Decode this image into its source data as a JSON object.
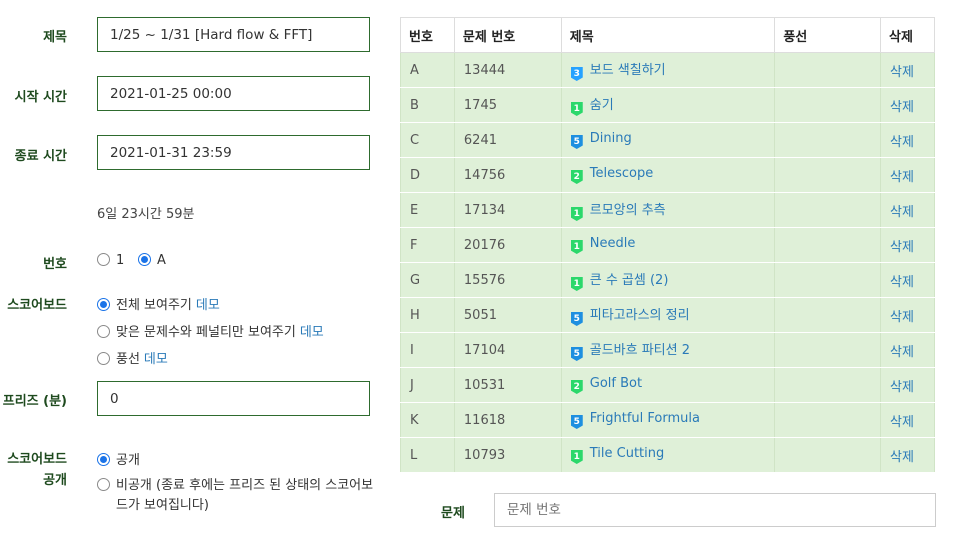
{
  "form": {
    "title_label": "제목",
    "title_value": "1/25 ~ 1/31 [Hard flow & FFT]",
    "start_label": "시작 시간",
    "start_value": "2021-01-25 00:00",
    "end_label": "종료 시간",
    "end_value": "2021-01-31 23:59",
    "duration_text": "6일 23시간 59분",
    "number_label": "번호",
    "number_options": [
      "1",
      "A"
    ],
    "number_selected": "A",
    "scoreboard_label": "스코어보드",
    "scoreboard_options": [
      {
        "text": "전체 보여주기",
        "demo": "데모",
        "selected": true
      },
      {
        "text": "맞은 문제수와 페널티만 보여주기",
        "demo": "데모",
        "selected": false
      },
      {
        "text": "풍선",
        "demo": "데모",
        "selected": false
      }
    ],
    "freeze_label": "프리즈 (분)",
    "freeze_value": "0",
    "public_label_line1": "스코어보드",
    "public_label_line2": "공개",
    "public_options": [
      {
        "text": "공개",
        "selected": true
      },
      {
        "text_line1": "비공개 (종료 후에는 프리즈 된 상태의 스코어보",
        "text_line2": "드가 보여집니다)",
        "selected": false
      }
    ]
  },
  "problem_table": {
    "headers": [
      "번호",
      "문제 번호",
      "제목",
      "풍선",
      "삭제"
    ],
    "rows": [
      {
        "label": "A",
        "id": "13444",
        "tier": "3",
        "tier_color": "#27a2ff",
        "title": "보드 색칠하기",
        "delete": "삭제"
      },
      {
        "label": "B",
        "id": "1745",
        "tier": "1",
        "tier_color": "#2bd86b",
        "title": "숨기",
        "delete": "삭제"
      },
      {
        "label": "C",
        "id": "6241",
        "tier": "5",
        "tier_color": "#1e8fe0",
        "title": "Dining",
        "delete": "삭제"
      },
      {
        "label": "D",
        "id": "14756",
        "tier": "2",
        "tier_color": "#2bd86b",
        "title": "Telescope",
        "delete": "삭제"
      },
      {
        "label": "E",
        "id": "17134",
        "tier": "1",
        "tier_color": "#2bd86b",
        "title": "르모앙의 추측",
        "delete": "삭제"
      },
      {
        "label": "F",
        "id": "20176",
        "tier": "1",
        "tier_color": "#2bd86b",
        "title": "Needle",
        "delete": "삭제"
      },
      {
        "label": "G",
        "id": "15576",
        "tier": "1",
        "tier_color": "#2bd86b",
        "title": "큰 수 곱셈 (2)",
        "delete": "삭제"
      },
      {
        "label": "H",
        "id": "5051",
        "tier": "5",
        "tier_color": "#1e8fe0",
        "title": "피타고라스의 정리",
        "delete": "삭제"
      },
      {
        "label": "I",
        "id": "17104",
        "tier": "5",
        "tier_color": "#1e8fe0",
        "title": "골드바흐 파티션 2",
        "delete": "삭제"
      },
      {
        "label": "J",
        "id": "10531",
        "tier": "2",
        "tier_color": "#2bd86b",
        "title": "Golf Bot",
        "delete": "삭제"
      },
      {
        "label": "K",
        "id": "11618",
        "tier": "5",
        "tier_color": "#1e8fe0",
        "title": "Frightful Formula",
        "delete": "삭제"
      },
      {
        "label": "L",
        "id": "10793",
        "tier": "1",
        "tier_color": "#2bd86b",
        "title": "Tile Cutting",
        "delete": "삭제"
      }
    ]
  },
  "add_problem": {
    "label": "문제",
    "placeholder": "문제 번호"
  }
}
